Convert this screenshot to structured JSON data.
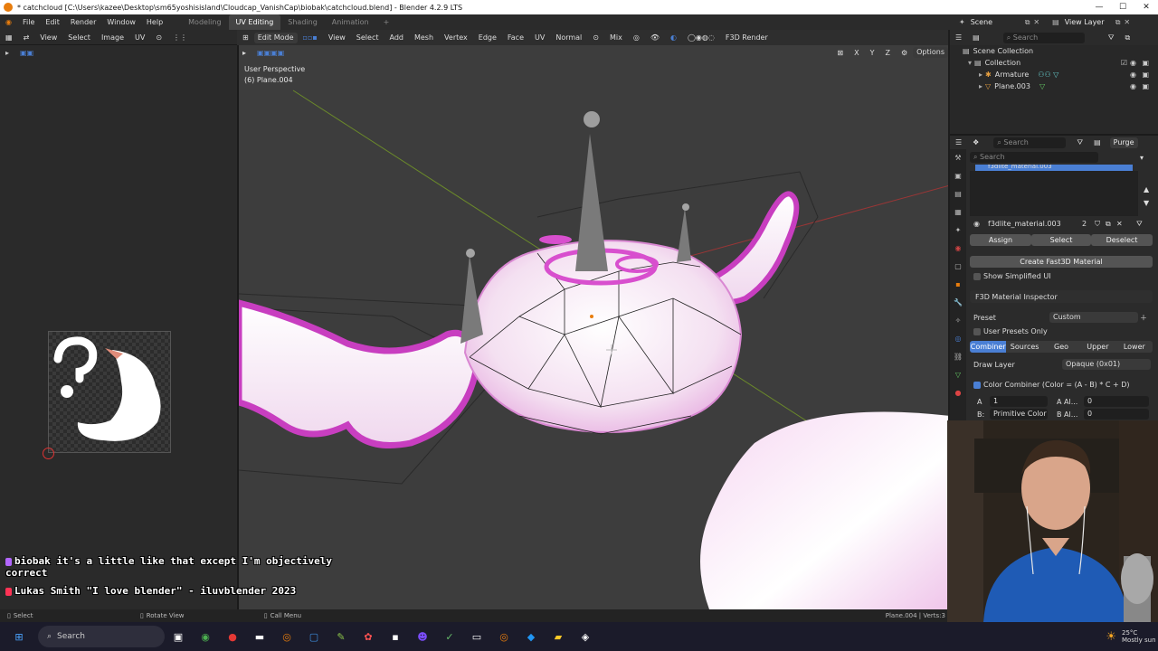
{
  "titlebar": {
    "title": "* catchcloud [C:\\Users\\kazee\\Desktop\\sm65yoshisisland\\Cloudcap_VanishCap\\biobak\\catchcloud.blend] - Blender 4.2.9 LTS"
  },
  "menu": [
    "File",
    "Edit",
    "Render",
    "Window",
    "Help"
  ],
  "workspaces": [
    {
      "label": "Modeling",
      "active": false
    },
    {
      "label": "UV Editing",
      "active": true
    },
    {
      "label": "Shading",
      "active": false
    },
    {
      "label": "Animation",
      "active": false
    }
  ],
  "add_workspace": "+",
  "top_right": {
    "scene": "Scene",
    "view_layer": "View Layer"
  },
  "uv_editor": {
    "menus": [
      "View",
      "Select",
      "Image",
      "UV"
    ]
  },
  "viewport": {
    "mode": "Edit Mode",
    "menus": [
      "View",
      "Select",
      "Add",
      "Mesh",
      "Vertex",
      "Edge",
      "Face",
      "UV"
    ],
    "orientation": "Normal",
    "snap_mix": "Mix",
    "engine": "F3D Render",
    "perspective": "User Perspective",
    "object": "(6) Plane.004",
    "axes": [
      "X",
      "Y",
      "Z"
    ],
    "options": "Options"
  },
  "outliner": {
    "search": "Search",
    "rows": [
      {
        "label": "Scene Collection",
        "indent": 0
      },
      {
        "label": "Collection",
        "indent": 1
      },
      {
        "label": "Armature",
        "indent": 2
      },
      {
        "label": "Plane.003",
        "indent": 2
      }
    ]
  },
  "properties": {
    "search": "Search",
    "purge": "Purge",
    "material_search": "Search",
    "material_list_item": "f3dlite_material.003",
    "material_name": "f3dlite_material.003",
    "users": "2",
    "assign": "Assign",
    "select": "Select",
    "deselect": "Deselect",
    "create_material": "Create Fast3D Material",
    "show_simplified": "Show Simplified UI",
    "inspector": "F3D Material Inspector",
    "preset_label": "Preset",
    "preset_value": "Custom",
    "user_presets": "User Presets Only",
    "tabs": [
      "Combiner",
      "Sources",
      "Geo",
      "Upper",
      "Lower"
    ],
    "draw_layer_label": "Draw Layer",
    "draw_layer_value": "Opaque (0x01)",
    "color_combiner": "Color Combiner (Color = (A - B) * C + D)",
    "row_a_label": "A",
    "row_a_value": "1",
    "row_a_alpha_label": "A Al...",
    "row_a_alpha_value": "0",
    "row_b_label": "B:",
    "row_b_value": "Primitive Color",
    "row_b_alpha_label": "B Al...",
    "row_b_alpha_value": "0"
  },
  "chat": [
    {
      "user": "biobak",
      "text": "it's a little like that except I'm objectively correct",
      "badge_color": "#b266ff"
    },
    {
      "user": "Lukas Smith",
      "text": "\"I love blender\" - iluvblender 2023",
      "badge_color": "#ff3355"
    }
  ],
  "status": {
    "select": "Select",
    "rotate": "Rotate View",
    "call_menu": "Call Menu",
    "info": "Plane.004 | Verts:3"
  },
  "taskbar": {
    "search": "Search",
    "weather_temp": "25°C",
    "weather_text": "Mostly sun"
  },
  "colors": {
    "accent_blue": "#4a7fd4",
    "blender_orange": "#e87d0d",
    "cloud_pink": "#e066d8"
  }
}
